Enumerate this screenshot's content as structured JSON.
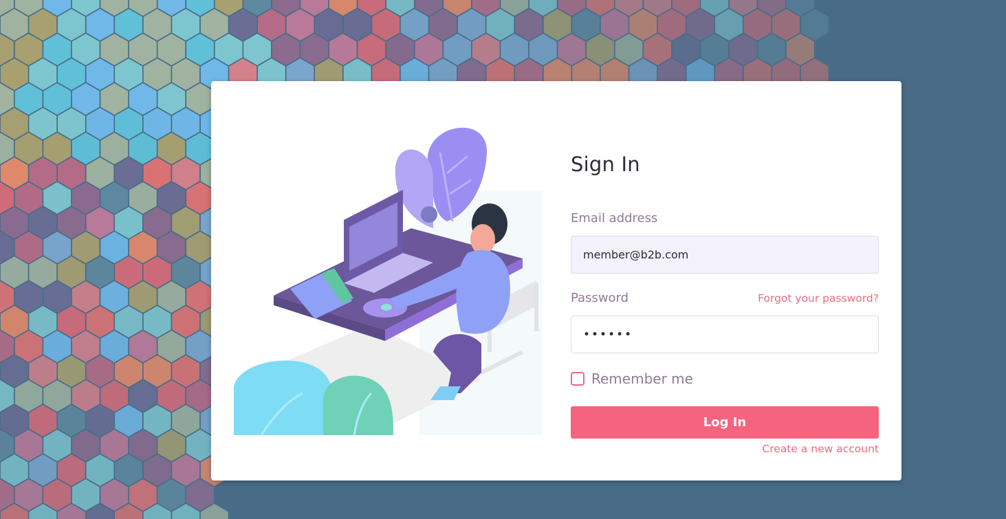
{
  "signin": {
    "title": "Sign In",
    "email_label": "Email address",
    "email_value": "member@b2b.com",
    "password_label": "Password",
    "password_value": "••••••",
    "forgot_link": "Forgot your password?",
    "remember_label": "Remember me",
    "remember_checked": false,
    "login_button": "Log In",
    "create_account_link": "Create a new account"
  },
  "colors": {
    "accent": "#f6637f",
    "link": "#ec6a81",
    "label": "#8e7b97",
    "background": "#486c87",
    "card": "#ffffff"
  },
  "illustration": {
    "icon": "person-at-desk-illustration"
  }
}
